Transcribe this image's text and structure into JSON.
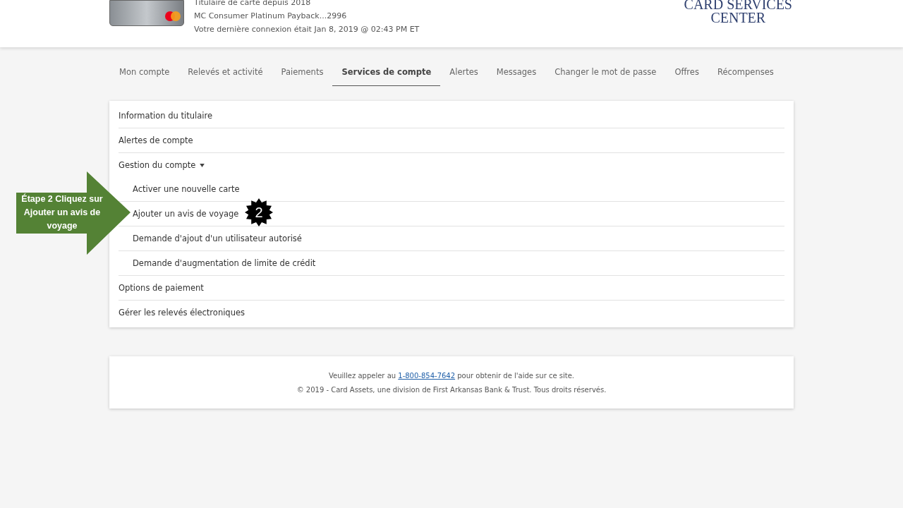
{
  "header": {
    "card_lines": [
      "Titulaire de carte depuis 2018",
      "MC Consumer Platinum Payback...2996",
      "Votre dernière connexion était Jan 8, 2019 @ 02:43 PM ET"
    ],
    "logo_lines": [
      "CARD SERVICES",
      "CENTER"
    ]
  },
  "tabs": [
    {
      "label": "Mon compte",
      "selected": false
    },
    {
      "label": "Relevés et activité",
      "selected": false
    },
    {
      "label": "Paiements",
      "selected": false
    },
    {
      "label": "Services de compte",
      "selected": true
    },
    {
      "label": "Alertes",
      "selected": false
    },
    {
      "label": "Messages",
      "selected": false
    },
    {
      "label": "Changer le mot de passe",
      "selected": false
    },
    {
      "label": "Offres",
      "selected": false
    },
    {
      "label": "Récompenses",
      "selected": false
    }
  ],
  "menu": [
    {
      "label": "Information du titulaire"
    },
    {
      "label": "Alertes de compte"
    },
    {
      "label": "Gestion du compte",
      "expanded": true,
      "children": [
        {
          "label": "Activer une nouvelle carte"
        },
        {
          "label": "Ajouter un avis de voyage"
        },
        {
          "label": "Demande d'ajout d'un utilisateur autorisé"
        },
        {
          "label": "Demande d'augmentation de limite de crédit"
        }
      ]
    },
    {
      "label": "Options de paiement"
    },
    {
      "label": "Gérer les relevés électroniques"
    }
  ],
  "annotation": {
    "text": "Étape 2 Cliquez sur Ajouter un avis de voyage",
    "step": "2"
  },
  "footer": {
    "before": "Veuillez appeler au",
    "phone": "1-800-854-7642",
    "after": "pour obtenir de l'aide sur ce site.",
    "copyright": "© 2019 - Card Assets, une division de First Arkansas Bank & Trust. Tous droits réservés."
  }
}
